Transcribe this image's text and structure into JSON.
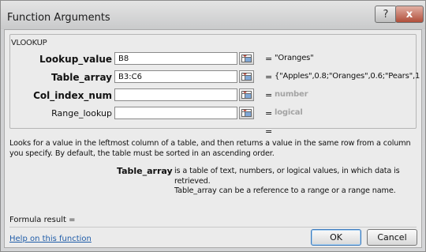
{
  "window": {
    "title": "Function Arguments"
  },
  "title_buttons": {
    "help": "?",
    "close": "x"
  },
  "function_name": "VLOOKUP",
  "arguments": [
    {
      "label": "Lookup_value",
      "value": "B8",
      "eq": "=",
      "result": "\"Oranges\"",
      "required": true
    },
    {
      "label": "Table_array",
      "value": "B3:C6",
      "eq": "=",
      "result": "{\"Apples\",0.8;\"Oranges\",0.6;\"Pears\",1;",
      "required": true
    },
    {
      "label": "Col_index_num",
      "value": "",
      "eq": "=",
      "result": "number",
      "required": true
    },
    {
      "label": "Range_lookup",
      "value": "",
      "eq": "=",
      "result": "logical",
      "required": false
    }
  ],
  "function_result_eq": "=",
  "description": "Looks for a value in the leftmost column of a table, and then returns a value in the same row from a column you specify. By default, the table must be sorted in an ascending order.",
  "argument_help": {
    "name": "Table_array",
    "text_line1": "is a table of text, numbers, or logical values, in which data is retrieved.",
    "text_line2": "Table_array can be a reference to a range or a range name."
  },
  "formula_result_label": "Formula result =",
  "help_link": "Help on this function",
  "buttons": {
    "ok": "OK",
    "cancel": "Cancel"
  },
  "icons": {
    "ref": "collapse-dialog-icon"
  }
}
